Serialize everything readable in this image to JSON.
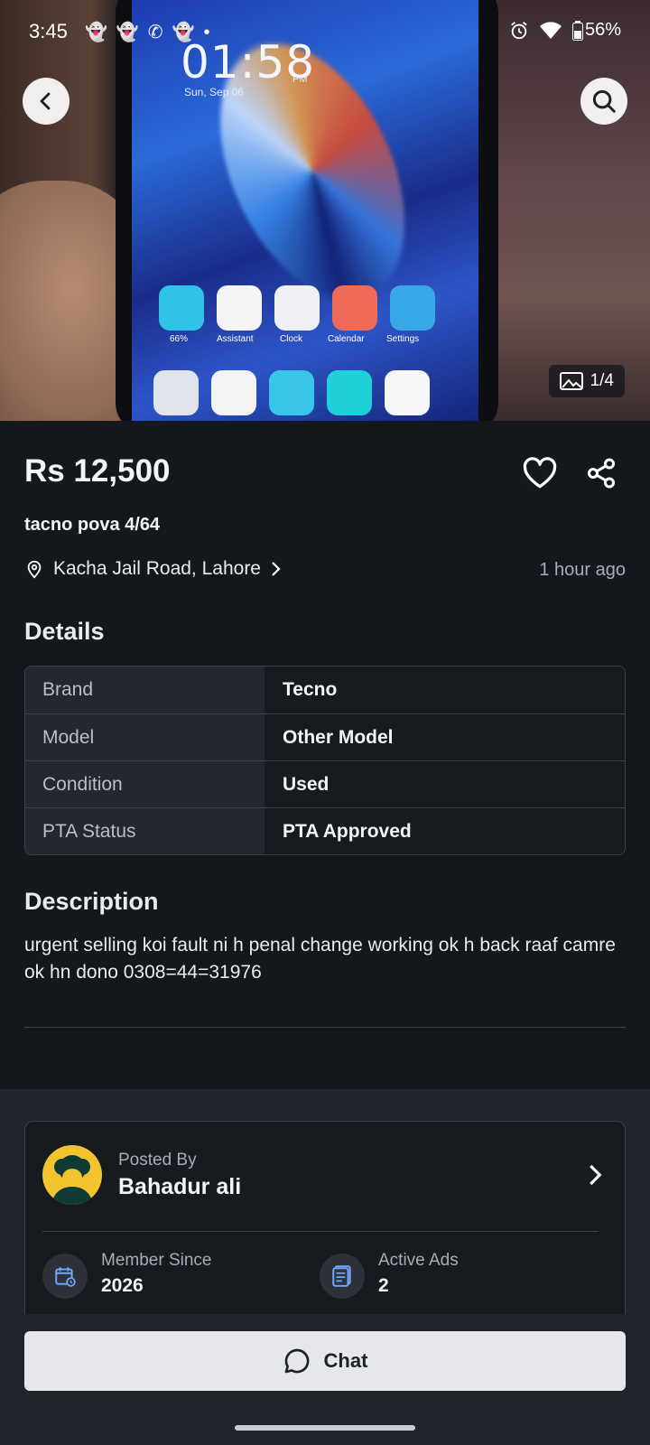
{
  "status_bar": {
    "time": "3:45",
    "notifications": "👻👻✆👻•",
    "battery": "56%"
  },
  "hero": {
    "photo_counter": "1/4",
    "lockscreen_time": "01:58",
    "lockscreen_ampm": "PM",
    "lockscreen_date": "Sun, Sep 06",
    "app_labels": [
      "66%",
      "Assistant",
      "Clock",
      "Calendar",
      "Settings"
    ]
  },
  "listing": {
    "price": "Rs 12,500",
    "title": "tacno pova 4/64",
    "location": "Kacha Jail Road, Lahore",
    "posted": "1 hour ago"
  },
  "details": {
    "heading": "Details",
    "rows": [
      {
        "key": "Brand",
        "value": "Tecno"
      },
      {
        "key": "Model",
        "value": "Other Model"
      },
      {
        "key": "Condition",
        "value": "Used"
      },
      {
        "key": "PTA Status",
        "value": "PTA Approved"
      }
    ]
  },
  "description": {
    "heading": "Description",
    "text": "urgent selling koi fault ni h penal change working ok h back raaf camre ok hn dono 0308=44=31976"
  },
  "seller": {
    "posted_by_label": "Posted By",
    "name": "Bahadur ali",
    "member_since_label": "Member Since",
    "member_since": "2026",
    "active_ads_label": "Active Ads",
    "active_ads": "2"
  },
  "actions": {
    "chat_label": "Chat"
  },
  "colors": {
    "background": "#14171c",
    "card": "#171a1f",
    "border": "#3b4049",
    "chat_button": "#e5e7ea"
  }
}
